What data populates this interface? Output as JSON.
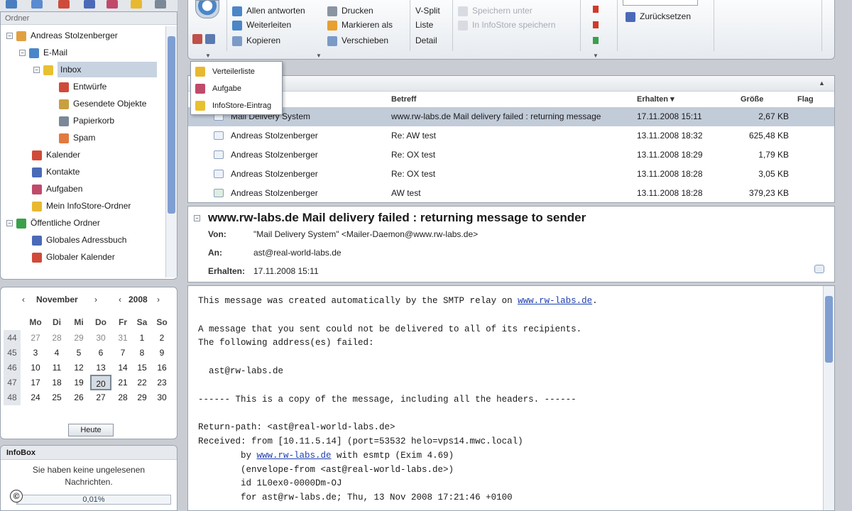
{
  "folders": {
    "header": "Ordner",
    "tree": [
      {
        "label": "Andreas Stolzenberger",
        "icon": "user-icon",
        "color": "#e0a040"
      },
      {
        "label": "E-Mail",
        "icon": "mail-folder-icon",
        "color": "#4a86c8"
      },
      {
        "label": "Inbox",
        "icon": "inbox-icon",
        "color": "#e8c030"
      },
      {
        "label": "Entwürfe",
        "icon": "drafts-icon",
        "color": "#d04a3a"
      },
      {
        "label": "Gesendete Objekte",
        "icon": "sent-icon",
        "color": "#c8a040"
      },
      {
        "label": "Papierkorb",
        "icon": "trash-icon",
        "color": "#7a8898"
      },
      {
        "label": "Spam",
        "icon": "spam-icon",
        "color": "#e07a40"
      },
      {
        "label": "Kalender",
        "icon": "calendar-folder-icon",
        "color": "#d04a3a"
      },
      {
        "label": "Kontakte",
        "icon": "contacts-icon",
        "color": "#4a6ab8"
      },
      {
        "label": "Aufgaben",
        "icon": "tasks-icon",
        "color": "#c04a6a"
      },
      {
        "label": "Mein InfoStore-Ordner",
        "icon": "infostore-icon",
        "color": "#e8b830"
      },
      {
        "label": "Öffentliche Ordner",
        "icon": "public-folder-icon",
        "color": "#3aa04a"
      },
      {
        "label": "Globales Adressbuch",
        "icon": "address-book-icon",
        "color": "#4a6ab8"
      },
      {
        "label": "Globaler Kalender",
        "icon": "global-calendar-icon",
        "color": "#d04a3a"
      }
    ]
  },
  "calendar": {
    "month": "November",
    "year": "2008",
    "prev": "‹",
    "next": "›",
    "day_names": [
      "Mo",
      "Di",
      "Mi",
      "Do",
      "Fr",
      "Sa",
      "So"
    ],
    "weeks": [
      {
        "wk": "44",
        "days": [
          "27",
          "28",
          "29",
          "30",
          "31",
          "1",
          "2"
        ]
      },
      {
        "wk": "45",
        "days": [
          "3",
          "4",
          "5",
          "6",
          "7",
          "8",
          "9"
        ]
      },
      {
        "wk": "46",
        "days": [
          "10",
          "11",
          "12",
          "13",
          "14",
          "15",
          "16"
        ]
      },
      {
        "wk": "47",
        "days": [
          "17",
          "18",
          "19",
          "20",
          "21",
          "22",
          "23"
        ]
      },
      {
        "wk": "48",
        "days": [
          "24",
          "25",
          "26",
          "27",
          "28",
          "29",
          "30"
        ]
      }
    ],
    "today_label": "Heute"
  },
  "infobox": {
    "title": "InfoBox",
    "message": "Sie haben keine ungelesenen Nachrichten.",
    "quota": "0,01%",
    "quota_fraction": 0.0001
  },
  "ribbon": {
    "col1": [
      "Allen antworten",
      "Weiterleiten",
      "Kopieren"
    ],
    "col2": [
      "Drucken",
      "Markieren als",
      "Verschieben"
    ],
    "col3": [
      "V-Split",
      "Liste",
      "Detail"
    ],
    "col4": [
      "Speichern unter",
      "In InfoStore speichern"
    ],
    "reset": "Zurücksetzen"
  },
  "dropdown": [
    "Verteilerliste",
    "Aufgabe",
    "InfoStore-Eintrag"
  ],
  "maillist": {
    "columns": {
      "subject": "Betreff",
      "received": "Erhalten ▾",
      "size": "Größe",
      "flag": "Flag"
    },
    "rows": [
      {
        "from": "Mail Delivery System",
        "subject": "www.rw-labs.de Mail delivery failed : returning message",
        "date": "17.11.2008 15:11",
        "size": "2,67 KB"
      },
      {
        "from": "Andreas Stolzenberger",
        "subject": "Re: AW test",
        "date": "13.11.2008 18:32",
        "size": "625,48 KB"
      },
      {
        "from": "Andreas Stolzenberger",
        "subject": "Re: OX test",
        "date": "13.11.2008 18:29",
        "size": "1,79 KB"
      },
      {
        "from": "Andreas Stolzenberger",
        "subject": "Re: OX test",
        "date": "13.11.2008 18:28",
        "size": "3,05 KB"
      },
      {
        "from": "Andreas Stolzenberger",
        "subject": "AW test",
        "date": "13.11.2008 18:28",
        "size": "379,23 KB"
      }
    ]
  },
  "message": {
    "subject": "www.rw-labs.de Mail delivery failed : returning message to sender",
    "from_label": "Von:",
    "from": "\"Mail Delivery System\" <Mailer-Daemon@www.rw-labs.de>",
    "to_label": "An:",
    "to": "ast@real-world-labs.de",
    "received_label": "Erhalten:",
    "received": "17.11.2008 15:11",
    "body": {
      "l1a": "This message was created automatically by the SMTP relay on ",
      "l1link": "www.rw-labs.de",
      "l1b": ".",
      "l2": "A message that you sent could not be delivered to all of its recipients.",
      "l3": "The following address(es) failed:",
      "l4": "  ast@rw-labs.de",
      "l5": "------ This is a copy of the message, including all the headers. ------",
      "l6": "Return-path: <ast@real-world-labs.de>",
      "l7": "Received: from [10.11.5.14] (port=53532 helo=vps14.mwc.local)",
      "l8a": "        by ",
      "l8link": "www.rw-labs.de",
      "l8b": " with esmtp (Exim 4.69)",
      "l9": "        (envelope-from <ast@real-world-labs.de>)",
      "l10": "        id 1L0ex0-0000Dm-OJ",
      "l11": "        for ast@rw-labs.de; Thu, 13 Nov 2008 17:21:46 +0100"
    }
  },
  "copyright": "©"
}
